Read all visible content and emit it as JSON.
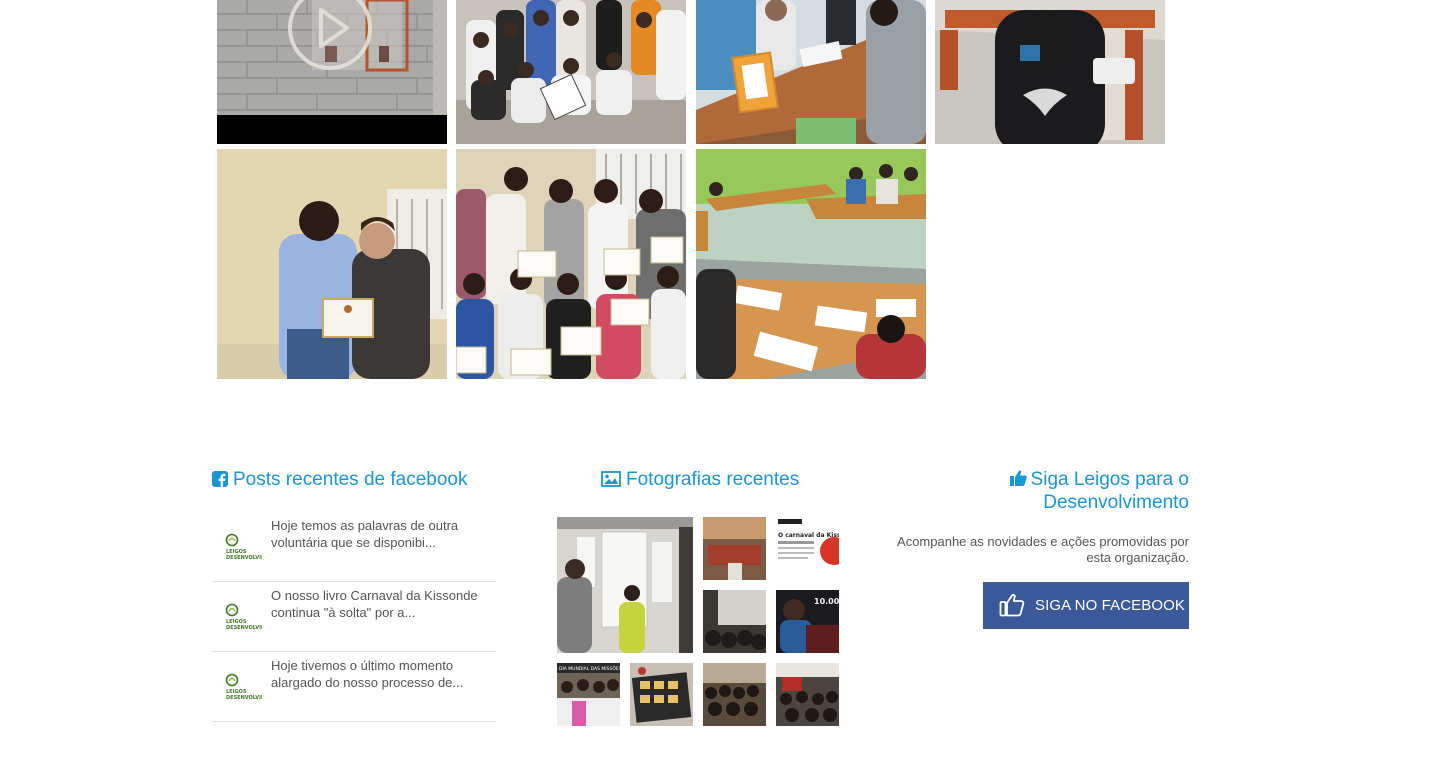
{
  "colors": {
    "accent": "#1a96d4",
    "facebook": "#3b5998",
    "divider": "#e3e3e3"
  },
  "gallery": {
    "items": [
      {
        "name": "gallery-video-wall",
        "type": "video"
      },
      {
        "name": "gallery-group-photo"
      },
      {
        "name": "gallery-classroom-desk"
      },
      {
        "name": "gallery-classroom-projector"
      },
      {
        "name": "gallery-certificate-handshake"
      },
      {
        "name": "gallery-certificate-group"
      },
      {
        "name": "gallery-classroom-tables"
      }
    ]
  },
  "facebook_posts": {
    "title": "Posts recentes de facebook",
    "icon": "facebook-square-icon",
    "posts": [
      {
        "text": "Hoje temos as palavras de outra voluntária que se disponibi..."
      },
      {
        "text": "O nosso livro Carnaval da Kissonde continua \"à solta\" por a..."
      },
      {
        "text": "Hoje tivemos o último momento alargado do nosso processo de..."
      }
    ]
  },
  "photos": {
    "title": "Fotografias recentes",
    "icon": "image-icon"
  },
  "follow": {
    "title_line1": "Siga Leigos para o",
    "title_line2": "Desenvolvimento",
    "icon": "thumbs-up-icon",
    "description_line1": "Acompanhe as novidades e ações promovidas por",
    "description_line2": "esta organização.",
    "button_label": "SIGA NO FACEBOOK"
  }
}
